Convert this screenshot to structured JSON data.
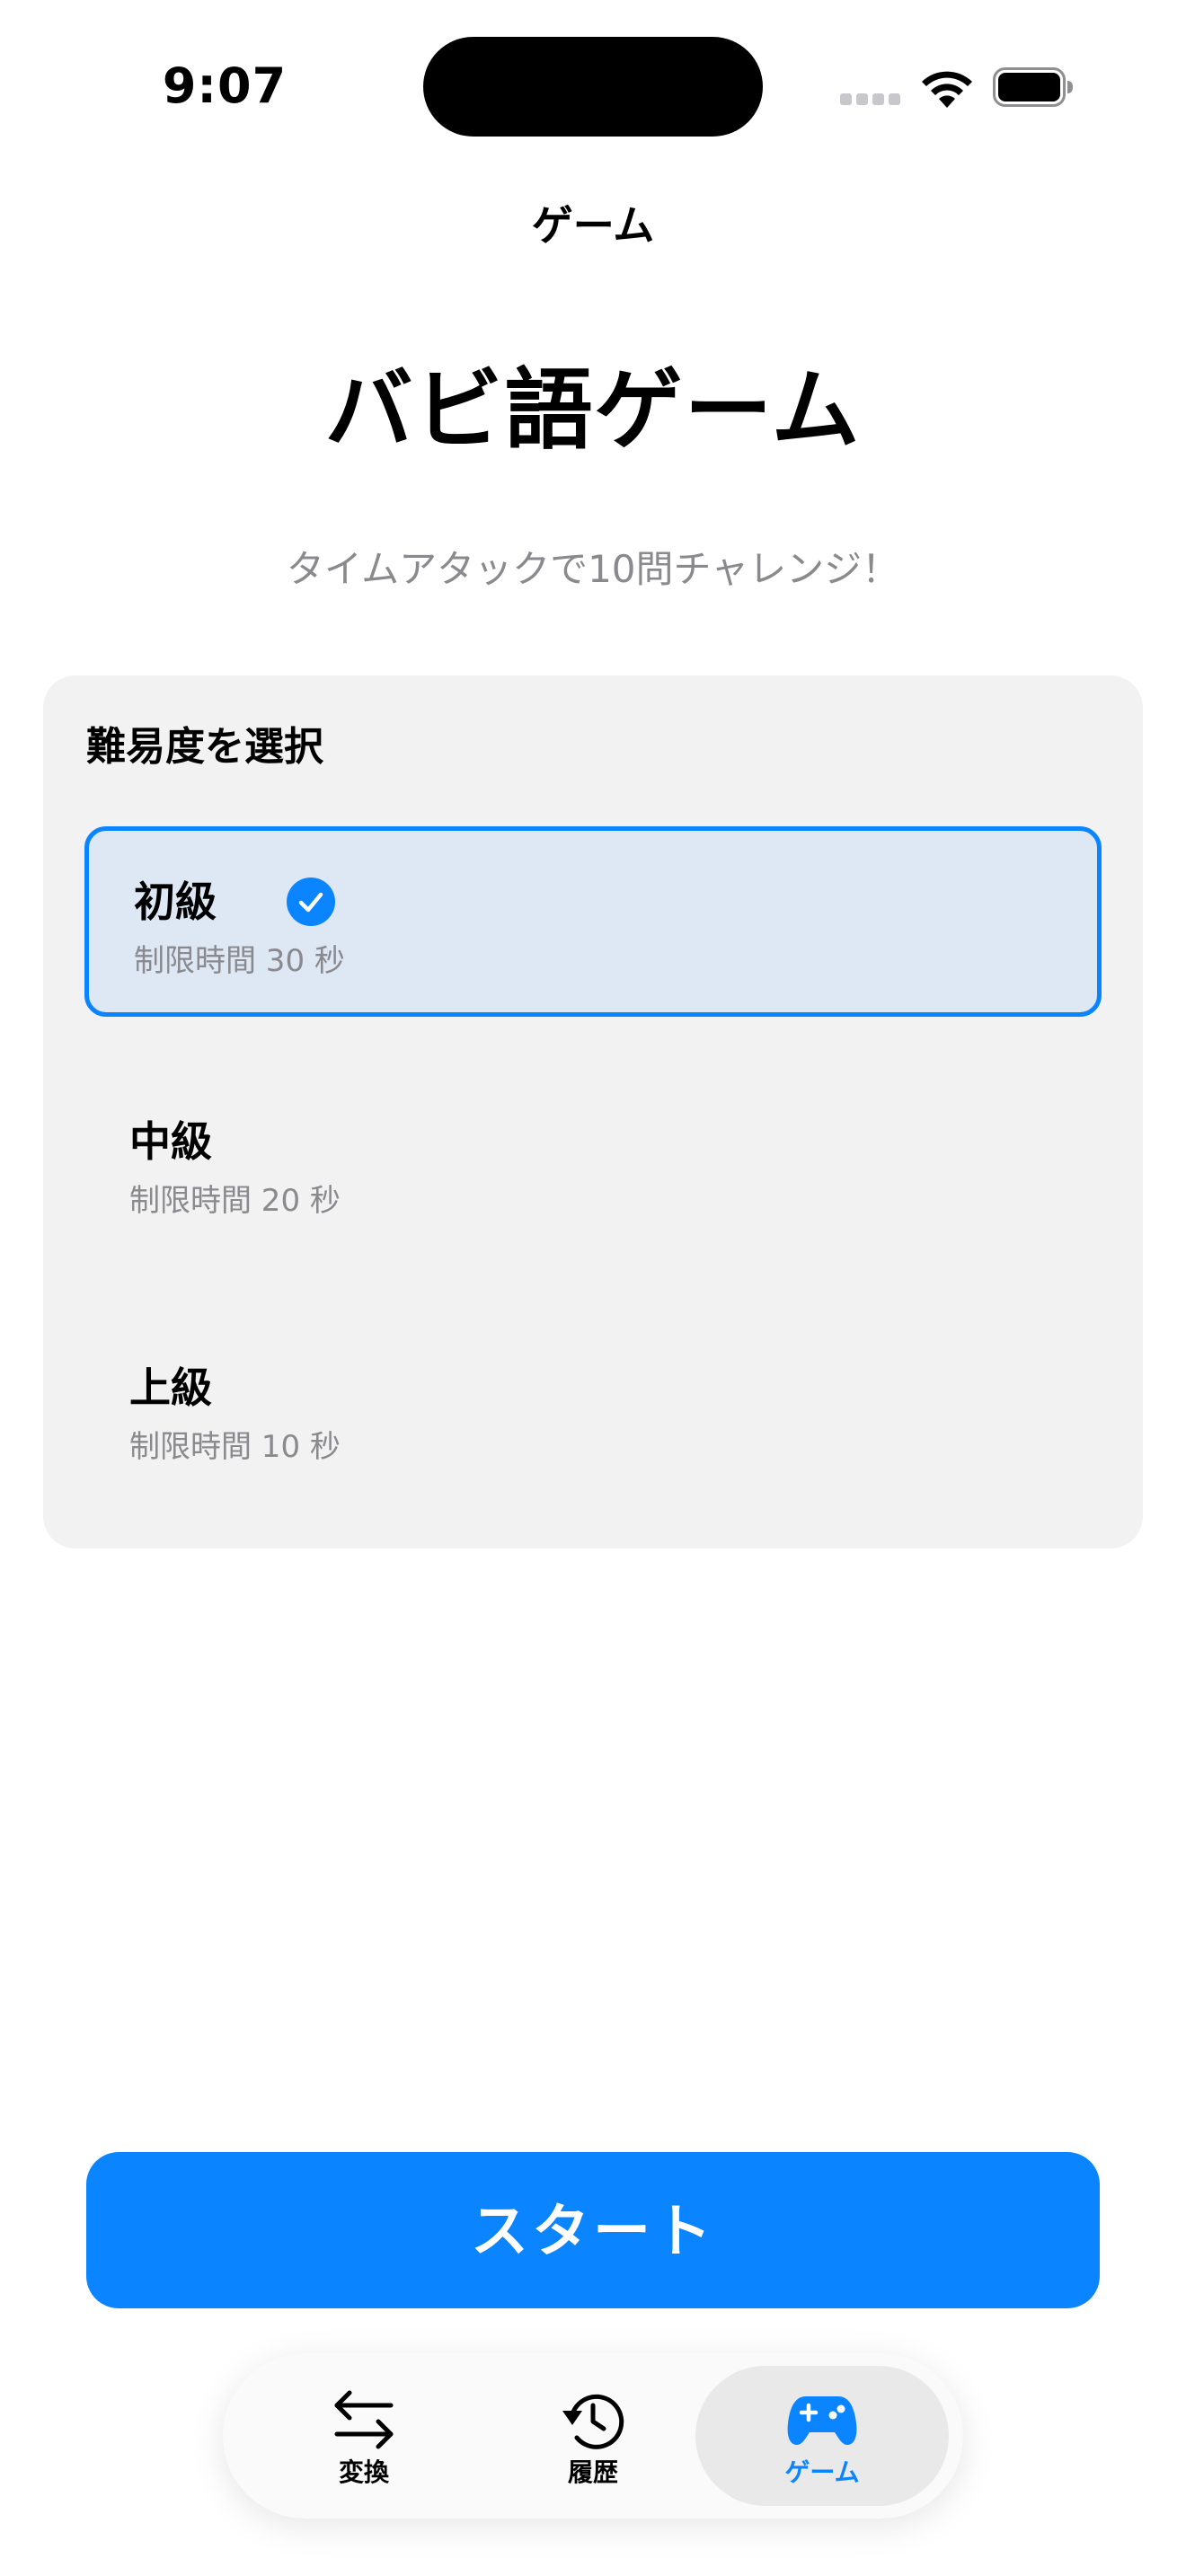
{
  "status_bar": {
    "time": "9:07"
  },
  "nav": {
    "title": "ゲーム"
  },
  "header": {
    "title": "バビ語ゲーム",
    "subtitle": "タイムアタックで10問チャレンジ！"
  },
  "difficulty": {
    "heading": "難易度を選択",
    "options": [
      {
        "name": "初級",
        "desc": "制限時間 30 秒",
        "selected": true
      },
      {
        "name": "中級",
        "desc": "制限時間 20 秒",
        "selected": false
      },
      {
        "name": "上級",
        "desc": "制限時間 10 秒",
        "selected": false
      }
    ]
  },
  "start_button": {
    "label": "スタート"
  },
  "tabs": [
    {
      "label": "変換",
      "icon": "arrows-swap-icon",
      "active": false
    },
    {
      "label": "履歴",
      "icon": "history-clock-icon",
      "active": false
    },
    {
      "label": "ゲーム",
      "icon": "gamecontroller-icon",
      "active": true
    }
  ],
  "colors": {
    "accent": "#0a84ff",
    "selected_bg": "#dde8f4",
    "card_bg": "#f2f2f2",
    "secondary_text": "#8a8a8e"
  }
}
